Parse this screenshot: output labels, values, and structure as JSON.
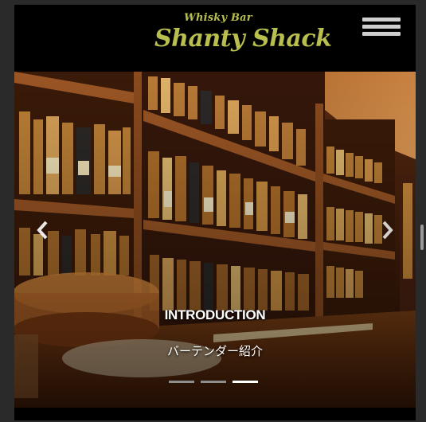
{
  "header": {
    "logo_sub": "Whisky Bar",
    "logo_main": "Shanty Shack",
    "menu_icon": "hamburger-menu-icon"
  },
  "slider": {
    "caption_title": "INTRODUCTION",
    "caption_subtitle": "バーテンダー紹介",
    "prev_icon": "chevron-left-icon",
    "next_icon": "chevron-right-icon",
    "slide_count": 3,
    "active_slide": 3
  },
  "colors": {
    "logo": "#b9bf4e",
    "header_bg": "#000000",
    "indicator_active": "#ffffff",
    "indicator_inactive": "#8d8d8d"
  }
}
